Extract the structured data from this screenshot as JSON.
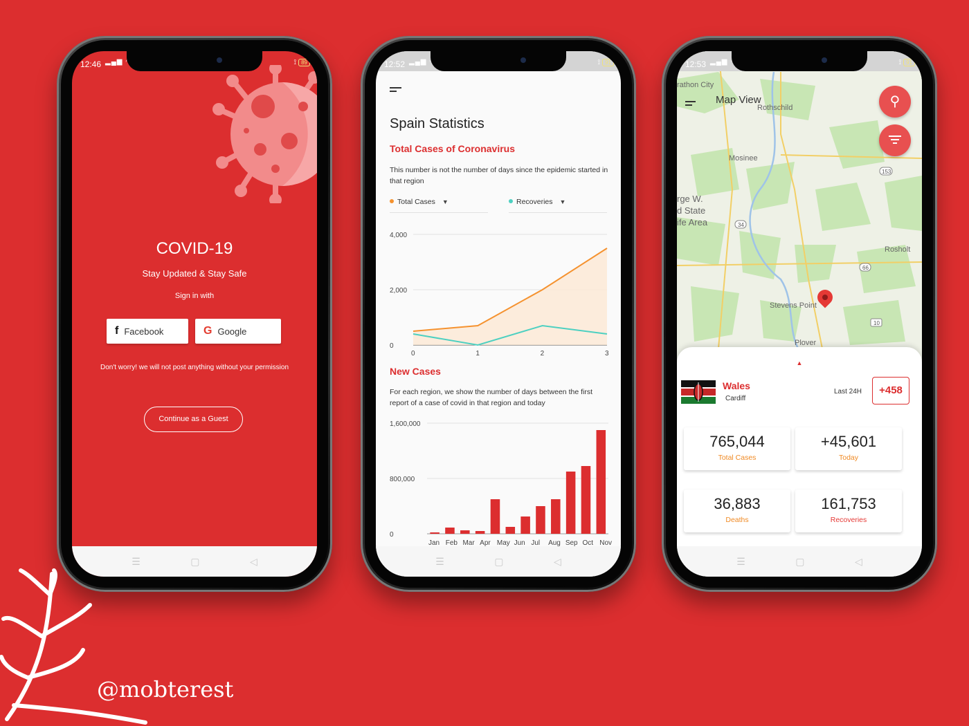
{
  "handle": "@mobterest",
  "phone1": {
    "status": {
      "time": "12:46",
      "battery": "89"
    },
    "title": "COVID-19",
    "subtitle": "Stay Updated & Stay Safe",
    "signin_label": "Sign in with",
    "facebook_label": "Facebook",
    "google_label": "Google",
    "note": "Don't worry! we will not post anything without your permission",
    "guest_label": "Continue as a Guest"
  },
  "phone2": {
    "status": {
      "time": "12:52",
      "battery": "91"
    },
    "title": "Spain Statistics",
    "section1_title": "Total Cases of Coronavirus",
    "section1_desc": "This number is not the number of days since the epidemic started in that region",
    "dropdown1": "Total Cases",
    "dropdown2": "Recoveries",
    "section2_title": "New Cases",
    "section2_desc": "For each region, we show the number of days between the first report of a case of covid in that region and today"
  },
  "chart_data": [
    {
      "type": "area",
      "x": [
        0,
        1,
        2,
        3
      ],
      "ylim": [
        0,
        4000
      ],
      "y_ticks": [
        "4,000",
        "2,000",
        "0"
      ],
      "x_ticks": [
        "0",
        "1",
        "2",
        "3"
      ],
      "series": [
        {
          "name": "Total Cases",
          "color": "#f5922f",
          "values": [
            500,
            700,
            2000,
            3500
          ]
        },
        {
          "name": "Recoveries",
          "color": "#4dd0c1",
          "values": [
            400,
            0,
            700,
            400
          ]
        }
      ]
    },
    {
      "type": "bar",
      "categories": [
        "Jan",
        "Feb",
        "Mar",
        "Apr",
        "May",
        "Jun",
        "Jul",
        "Aug",
        "Sep",
        "Oct",
        "Nov"
      ],
      "values": [
        20000,
        90000,
        50000,
        40000,
        500000,
        100000,
        250000,
        400000,
        500000,
        900000,
        980000,
        1500000
      ],
      "ylim": [
        0,
        1600000
      ],
      "y_ticks": [
        "1,600,000",
        "800,000",
        "0"
      ],
      "color": "#dc2e2f"
    }
  ],
  "phone3": {
    "status": {
      "time": "12:53",
      "battery": "91"
    },
    "map_title": "Map View",
    "map_labels": [
      "rathon City",
      "Rothschild",
      "Mosinee",
      "rge W.",
      "d State",
      "ife Area",
      "Rosholt",
      "Stevens Point",
      "Plover"
    ],
    "road_labels": [
      "153",
      "34",
      "66",
      "10"
    ],
    "country": "Wales",
    "city": "Cardiff",
    "last_label": "Last 24H",
    "last_value": "+458",
    "stats": [
      {
        "value": "765,044",
        "label": "Total Cases"
      },
      {
        "value": "+45,601",
        "label": "Today"
      },
      {
        "value": "36,883",
        "label": "Deaths"
      },
      {
        "value": "161,753",
        "label": "Recoveries"
      }
    ]
  }
}
